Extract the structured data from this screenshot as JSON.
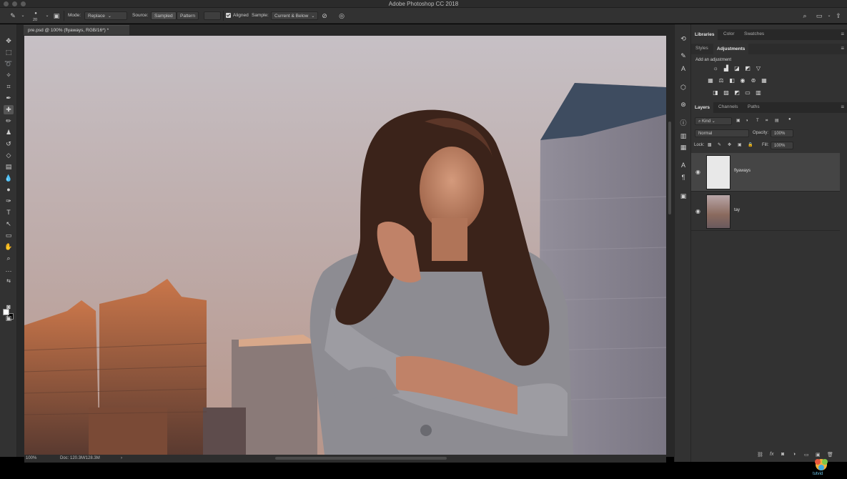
{
  "app_title": "Adobe Photoshop CC 2018",
  "options_bar": {
    "brush_size": "20",
    "mode_label": "Mode:",
    "mode_value": "Replace",
    "source_label": "Source:",
    "source_sampled": "Sampled",
    "source_pattern": "Pattern",
    "aligned_label": "Aligned",
    "sample_label": "Sample:",
    "sample_value": "Current & Below"
  },
  "document": {
    "tab_title": "pre.psd @ 100% (flyaways, RGB/16*) *",
    "zoom": "100%",
    "doc_size": "Doc: 120.3M/128.3M"
  },
  "top_panels": {
    "tabs": [
      "Libraries",
      "Color",
      "Swatches"
    ],
    "sub_tabs": [
      "Styles",
      "Adjustments"
    ],
    "add_adjustment": "Add an adjustment"
  },
  "layers_panel": {
    "tabs": [
      "Layers",
      "Channels",
      "Paths"
    ],
    "filter_kind": "Kind",
    "blend_mode": "Normal",
    "opacity_label": "Opacity:",
    "opacity_value": "100%",
    "lock_label": "Lock:",
    "fill_label": "Fill:",
    "fill_value": "100%",
    "layers": [
      {
        "name": "flyaways",
        "selected": true
      },
      {
        "name": "tay",
        "selected": false
      }
    ]
  },
  "logo_text": "tutvid",
  "colors": {
    "panel_bg": "#323232",
    "selected_layer": "#454545",
    "app_bg": "#282828"
  }
}
